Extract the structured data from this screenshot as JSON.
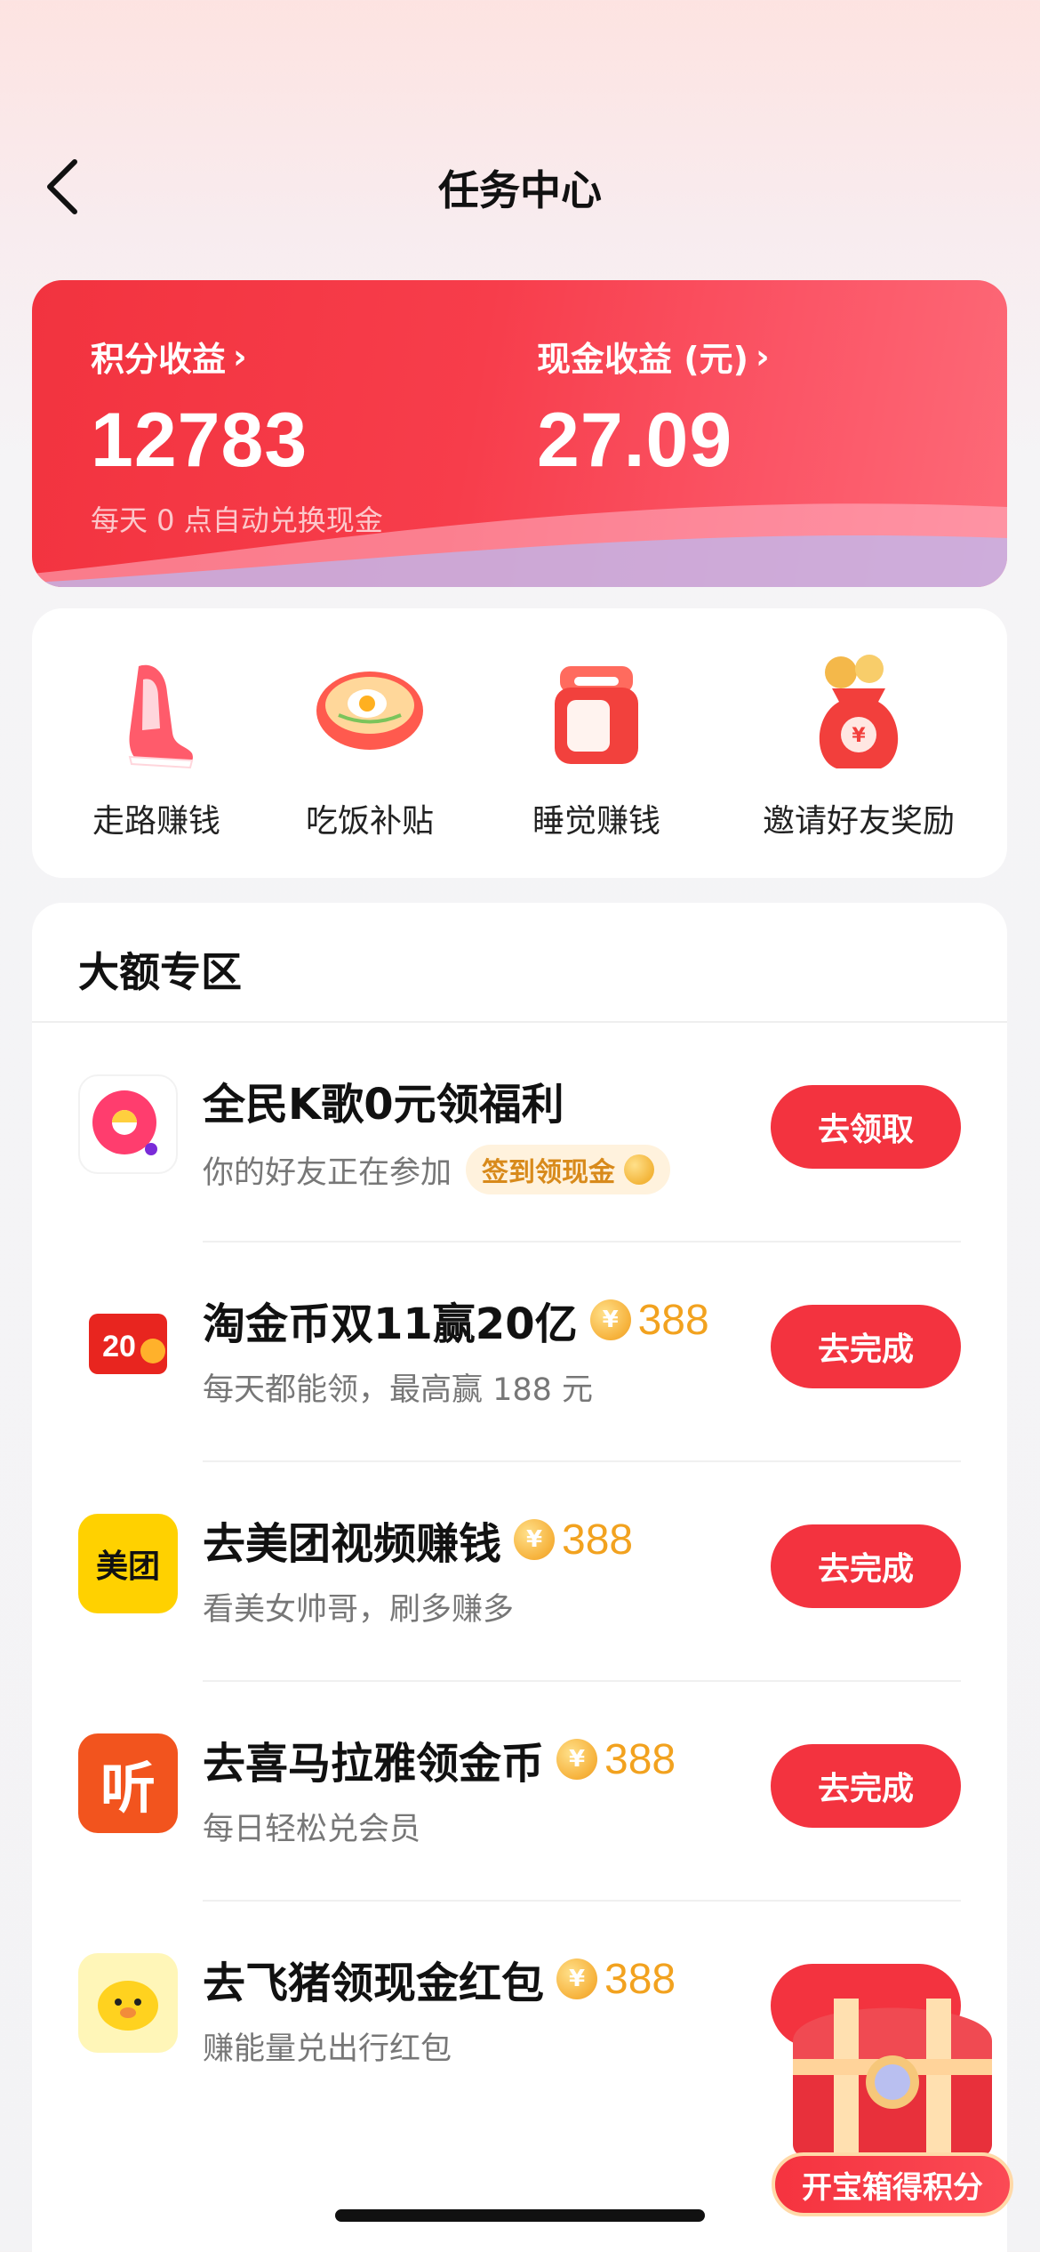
{
  "header": {
    "title": "任务中心"
  },
  "earnings": {
    "points_label": "积分收益",
    "points_value": "12783",
    "cash_label": "现金收益 (元)",
    "cash_value": "27.09",
    "note": "每天 0 点自动兑换现金"
  },
  "quick_actions": [
    {
      "label": "走路赚钱",
      "icon": "sneaker-icon"
    },
    {
      "label": "吃饭补贴",
      "icon": "rice-bowl-icon"
    },
    {
      "label": "睡觉赚钱",
      "icon": "alarm-clock-icon"
    },
    {
      "label": "邀请好友奖励",
      "icon": "money-bag-icon"
    }
  ],
  "section": {
    "title": "大额专区"
  },
  "tasks": [
    {
      "title": "全民K歌0元领福利",
      "subtitle": "你的好友正在参加",
      "tag": "签到领现金",
      "button": "去领取",
      "logo": "全民K歌"
    },
    {
      "title": "淘金币双11赢20亿",
      "reward": "388",
      "subtitle": "每天都能领，最高赢 188 元",
      "button": "去完成",
      "logo": "20亿"
    },
    {
      "title": "去美团视频赚钱",
      "reward": "388",
      "subtitle": "看美女帅哥，刷多赚多",
      "button": "去完成",
      "logo": "美团"
    },
    {
      "title": "去喜马拉雅领金币",
      "reward": "388",
      "subtitle": "每日轻松兑会员",
      "button": "去完成",
      "logo": "听"
    },
    {
      "title": "去飞猪领现金红包",
      "reward": "388",
      "subtitle": "赚能量兑出行红包",
      "logo": "飞猪"
    }
  ],
  "coin_symbol": "¥",
  "treasure": {
    "label": "开宝箱得积分"
  },
  "colors": {
    "primary": "#f3333f",
    "coin": "#f2a21f"
  }
}
